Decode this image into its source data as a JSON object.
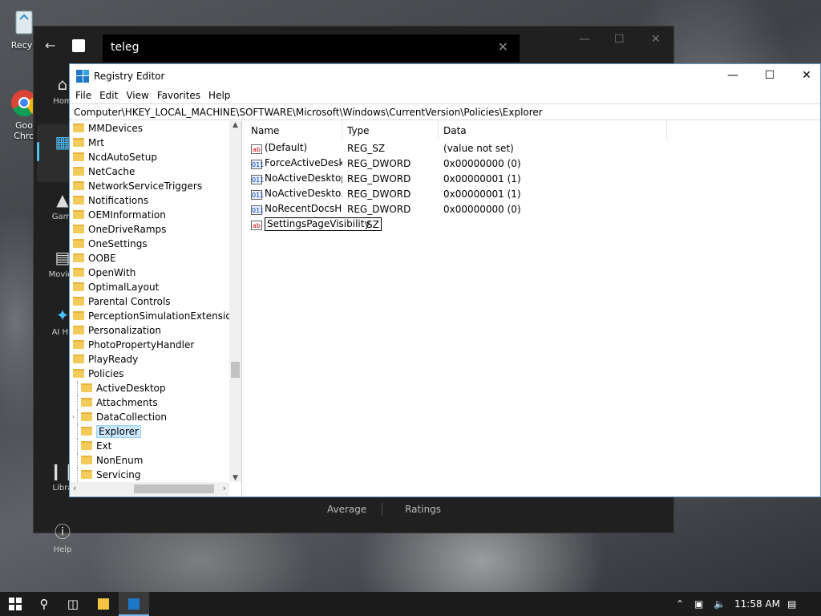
{
  "desktop": {
    "icons": [
      {
        "label": "Recyc"
      },
      {
        "label": "Goo\nChro"
      }
    ]
  },
  "background_app": {
    "search_value": "teleg",
    "nav": [
      {
        "label": "Hom"
      },
      {
        "label": ""
      },
      {
        "label": "Gami"
      },
      {
        "label": "Movies"
      },
      {
        "label": "AI Hu"
      },
      {
        "label": "Libra"
      },
      {
        "label": "Help"
      }
    ],
    "tabs": [
      "Average",
      "Ratings"
    ]
  },
  "regedit": {
    "title": "Registry Editor",
    "menu": [
      "File",
      "Edit",
      "View",
      "Favorites",
      "Help"
    ],
    "address": "Computer\\HKEY_LOCAL_MACHINE\\SOFTWARE\\Microsoft\\Windows\\CurrentVersion\\Policies\\Explorer",
    "tree": [
      {
        "label": "MMDevices",
        "level": 0
      },
      {
        "label": "Mrt",
        "level": 0
      },
      {
        "label": "NcdAutoSetup",
        "level": 0
      },
      {
        "label": "NetCache",
        "level": 0
      },
      {
        "label": "NetworkServiceTriggers",
        "level": 0
      },
      {
        "label": "Notifications",
        "level": 0
      },
      {
        "label": "OEMInformation",
        "level": 0
      },
      {
        "label": "OneDriveRamps",
        "level": 0
      },
      {
        "label": "OneSettings",
        "level": 0
      },
      {
        "label": "OOBE",
        "level": 0
      },
      {
        "label": "OpenWith",
        "level": 0
      },
      {
        "label": "OptimalLayout",
        "level": 0
      },
      {
        "label": "Parental Controls",
        "level": 0
      },
      {
        "label": "PerceptionSimulationExtensions",
        "level": 0
      },
      {
        "label": "Personalization",
        "level": 0
      },
      {
        "label": "PhotoPropertyHandler",
        "level": 0
      },
      {
        "label": "PlayReady",
        "level": 0
      },
      {
        "label": "Policies",
        "level": 0
      },
      {
        "label": "ActiveDesktop",
        "level": 1
      },
      {
        "label": "Attachments",
        "level": 1
      },
      {
        "label": "DataCollection",
        "level": 1
      },
      {
        "label": "Explorer",
        "level": 1,
        "selected": true
      },
      {
        "label": "Ext",
        "level": 1
      },
      {
        "label": "NonEnum",
        "level": 1
      },
      {
        "label": "Servicing",
        "level": 1
      }
    ],
    "columns": [
      "Name",
      "Type",
      "Data"
    ],
    "values": [
      {
        "name": "(Default)",
        "type": "REG_SZ",
        "data": "(value not set)",
        "icon": "ab"
      },
      {
        "name": "ForceActiveDesk...",
        "type": "REG_DWORD",
        "data": "0x00000000 (0)",
        "icon": "011"
      },
      {
        "name": "NoActiveDesktop",
        "type": "REG_DWORD",
        "data": "0x00000001 (1)",
        "icon": "011"
      },
      {
        "name": "NoActiveDeskto...",
        "type": "REG_DWORD",
        "data": "0x00000001 (1)",
        "icon": "011"
      },
      {
        "name": "NoRecentDocsH...",
        "type": "REG_DWORD",
        "data": "0x00000000 (0)",
        "icon": "011"
      },
      {
        "name": "SettingsPageVisibility",
        "type": "SZ",
        "data": "",
        "icon": "ab",
        "editing": true
      }
    ]
  },
  "taskbar": {
    "time": "11:58 AM"
  }
}
